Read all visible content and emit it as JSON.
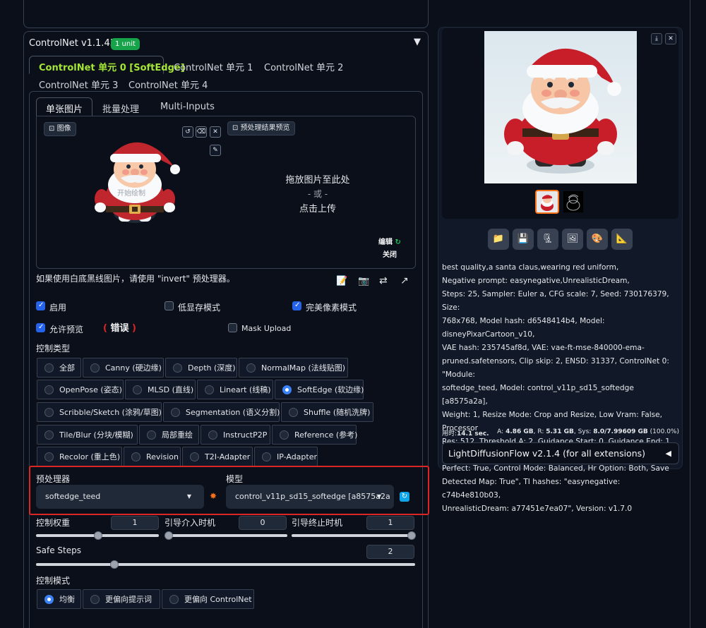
{
  "controlnet": {
    "title": "ControlNet v1.1.438",
    "badge": "1 unit",
    "collapse_icon": "▼",
    "unit_tabs": [
      "ControlNet 单元 0 [SoftEdge]",
      "ControlNet 单元 1",
      "ControlNet 单元 2",
      "ControlNet 单元 3",
      "ControlNet 单元 4"
    ],
    "input_tabs": [
      "单张图片",
      "批量处理",
      "Multi-Inputs"
    ],
    "image_label": "图像",
    "preview_label": "预处理结果预览",
    "watermark_text": "开始绘制",
    "upload": {
      "line1": "拖放图片至此处",
      "line2": "- 或 -",
      "line3": "点击上传"
    },
    "edit_label": "编辑",
    "close_label": "关闭",
    "hint": "如果使用白底黑线图片，请使用 \"invert\" 预处理器。",
    "checkboxes": {
      "enable": "启用",
      "low_vram": "低显存模式",
      "pixel_perfect": "完美像素模式",
      "allow_preview": "允许预览",
      "mask_upload": "Mask Upload"
    },
    "error_label": "错误",
    "control_type_label": "控制类型",
    "control_types": [
      [
        "全部",
        "Canny (硬边缘)",
        "Depth (深度)",
        "NormalMap (法线贴图)"
      ],
      [
        "OpenPose (姿态)",
        "MLSD (直线)",
        "Lineart (线稿)",
        "SoftEdge (软边缘)"
      ],
      [
        "Scribble/Sketch (涂鸦/草图)",
        "Segmentation (语义分割)",
        "Shuffle (随机洗牌)"
      ],
      [
        "Tile/Blur (分块/模糊)",
        "局部重绘",
        "InstructP2P",
        "Reference (参考)"
      ],
      [
        "Recolor (重上色)",
        "Revision",
        "T2I-Adapter",
        "IP-Adapter"
      ]
    ],
    "selected_control_type": "SoftEdge (软边缘)",
    "preprocessor_label": "预处理器",
    "preprocessor_value": "softedge_teed",
    "model_label": "模型",
    "model_value": "control_v11p_sd15_softedge [a8575a2a",
    "weight_label": "控制权重",
    "weight_value": "1",
    "start_label": "引导介入时机",
    "start_value": "0",
    "end_label": "引导终止时机",
    "end_value": "1",
    "safe_steps_label": "Safe Steps",
    "safe_steps_value": "2",
    "control_mode_label": "控制模式",
    "control_modes": [
      "均衡",
      "更偏向提示词",
      "更偏向 ControlNet"
    ],
    "selected_control_mode": "均衡"
  },
  "output": {
    "info_lines": [
      "best quality,a santa claus,wearing red uniform,",
      "Negative prompt: easynegative,UnrealisticDream,",
      "Steps: 25, Sampler: Euler a, CFG scale: 7, Seed: 730176379, Size:",
      "768x768, Model hash: d6548414b4, Model: disneyPixarCartoon_v10,",
      "VAE hash: 235745af8d, VAE: vae-ft-mse-840000-ema-",
      "pruned.safetensors, Clip skip: 2, ENSD: 31337, ControlNet 0: \"Module:",
      "softedge_teed, Model: control_v11p_sd15_softedge [a8575a2a],",
      "Weight: 1, Resize Mode: Crop and Resize, Low Vram: False, Processor",
      "Res: 512, Threshold A: 2, Guidance Start: 0, Guidance End: 1, Pixel",
      "Perfect: True, Control Mode: Balanced, Hr Option: Both, Save",
      "Detected Map: True\", TI hashes: \"easynegative: c74b4e810b03,",
      "UnrealisticDream: a77451e7ea07\", Version: v1.7.0"
    ],
    "time_label": "用时:",
    "time_value": "14.1 sec.",
    "vram_text_a": "A: ",
    "vram_a": "4.86 GB",
    "vram_text_r": ", R: ",
    "vram_r": "5.31 GB",
    "vram_text_s": ", Sys: ",
    "vram_sys": "8.0/7.99609 GB",
    "vram_pct": " (100.0%)",
    "extension_label": "LightDiffusionFlow v2.1.4 (for all extensions)",
    "extension_icon": "◀"
  },
  "colors": {
    "accent": "#a3e635",
    "badge": "#16a34a",
    "checkbox": "#2563eb",
    "highlight": "#dc2626"
  }
}
